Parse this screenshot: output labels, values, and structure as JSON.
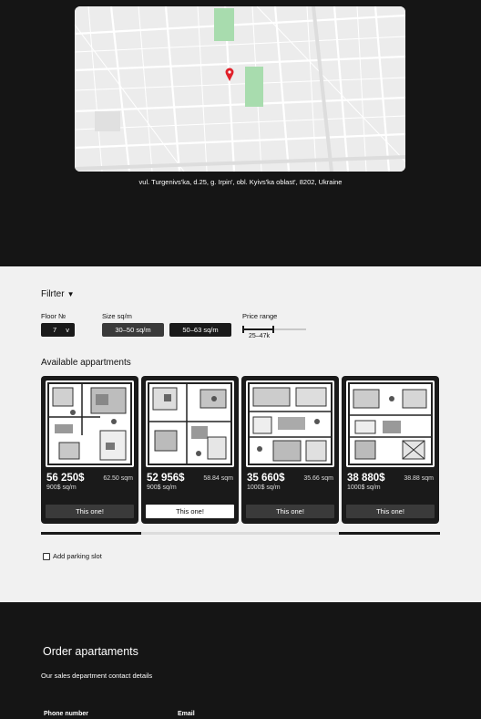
{
  "map": {
    "address": "vul. Turgenivs'ka, d.25, g. Irpin', obl. Kyivs'ka oblast', 8202, Ukraine"
  },
  "filters": {
    "title": "Filrter",
    "floor_label": "Floor №",
    "floor_value": "7",
    "floor_caret": "v",
    "size_label": "Size sq/m",
    "size_options": [
      "30–50 sq/m",
      "50–63 sq/m"
    ],
    "price_label": "Price range",
    "price_value": "25–47k",
    "price_range_fraction": [
      0.0,
      0.5
    ]
  },
  "apartments": {
    "title": "Available appartments",
    "items": [
      {
        "price": "56 250$",
        "area": "62.50 sqm",
        "price_per_m": "900$ sq/m",
        "button": "This one!",
        "selected": false
      },
      {
        "price": "52 956$",
        "area": "58.84 sqm",
        "price_per_m": "900$ sq/m",
        "button": "This one!",
        "selected": true
      },
      {
        "price": "35 660$",
        "area": "35.66 sqm",
        "price_per_m": "1000$ sq/m",
        "button": "This one!",
        "selected": false
      },
      {
        "price": "38 880$",
        "area": "38.88 sqm",
        "price_per_m": "1000$ sq/m",
        "button": "This one!",
        "selected": false
      }
    ]
  },
  "parking": {
    "label": "Add parking slot",
    "checked": false
  },
  "order": {
    "title": "Order apartaments",
    "subtitle": "Our sales department contact details",
    "phone_label": "Phone number",
    "email_label": "Email"
  },
  "colors": {
    "dark": "#151515",
    "panel": "#f1f1f1",
    "accent_pin": "#e0202a",
    "park_green": "#8fd39a"
  }
}
